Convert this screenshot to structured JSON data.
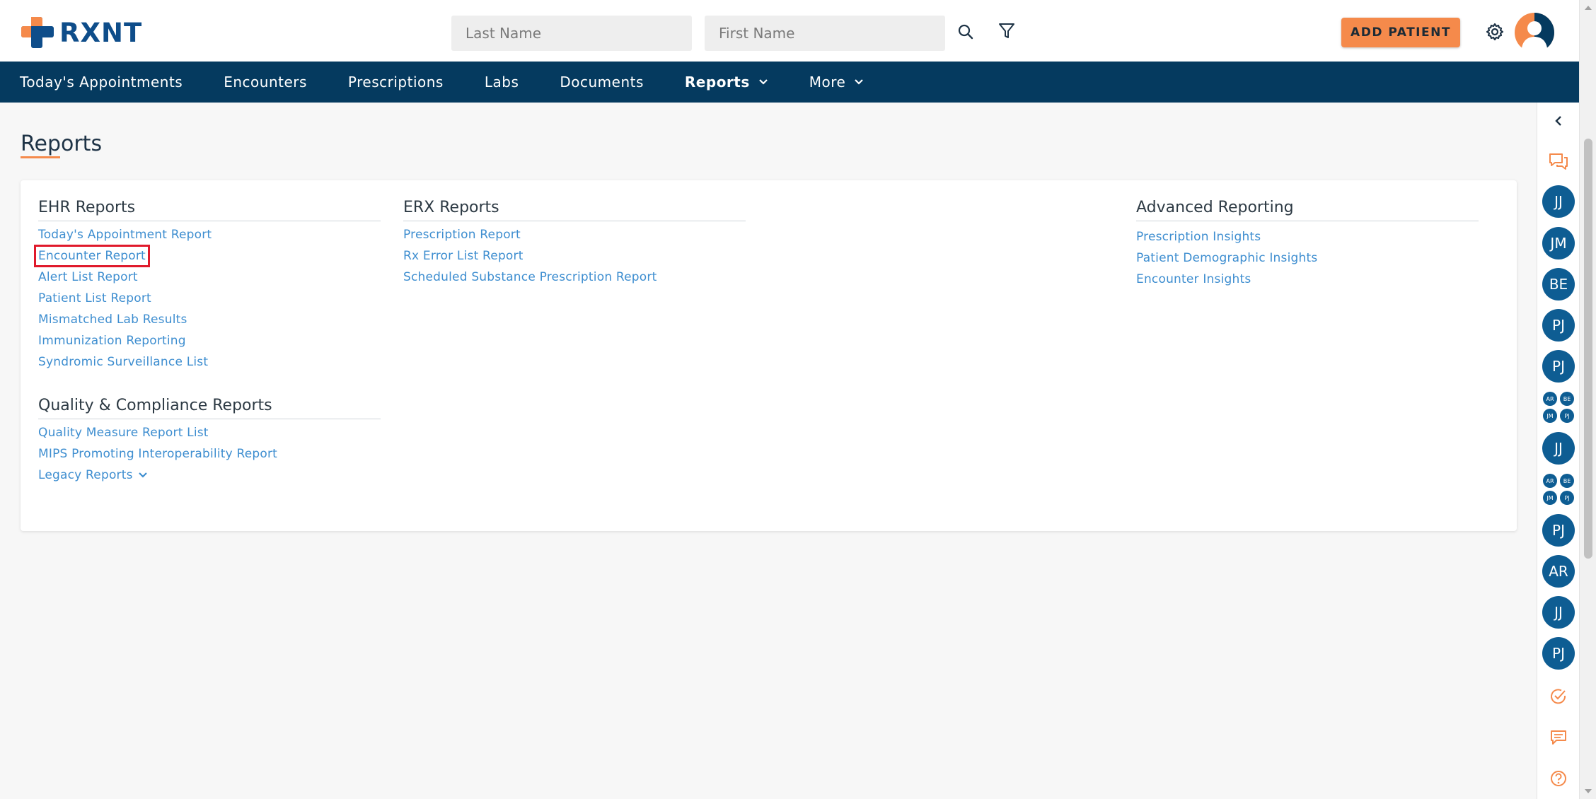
{
  "brand": {
    "name": "RXNT",
    "accent_orange": "#f58a4b",
    "navy": "#053a5f",
    "blue": "#0e4d8a"
  },
  "header": {
    "last_name_placeholder": "Last Name",
    "first_name_placeholder": "First Name",
    "search_icon": "search-icon",
    "filter_icon": "filter-icon",
    "add_patient_label": "ADD PATIENT",
    "settings_icon": "gear-icon",
    "avatar_icon": "user-avatar-icon"
  },
  "nav": {
    "items": [
      {
        "label": "Today's Appointments"
      },
      {
        "label": "Encounters"
      },
      {
        "label": "Prescriptions"
      },
      {
        "label": "Labs"
      },
      {
        "label": "Documents"
      },
      {
        "label": "Reports",
        "active": true,
        "dropdown": true
      },
      {
        "label": "More",
        "dropdown": true
      }
    ]
  },
  "page": {
    "title": "Reports"
  },
  "sections": {
    "ehr": {
      "title": "EHR Reports",
      "links": [
        "Today's Appointment Report",
        "Encounter Report",
        "Alert List Report",
        "Patient List Report",
        "Mismatched Lab Results",
        "Immunization Reporting",
        "Syndromic Surveillance List"
      ]
    },
    "quality": {
      "title": "Quality & Compliance Reports",
      "links": [
        "Quality Measure Report List",
        "MIPS Promoting Interoperability Report"
      ],
      "legacy_label": "Legacy Reports"
    },
    "erx": {
      "title": "ERX Reports",
      "links": [
        "Prescription Report",
        "Rx Error List Report",
        "Scheduled Substance Prescription Report"
      ]
    },
    "advanced": {
      "title": "Advanced Reporting",
      "links": [
        "Prescription Insights",
        "Patient Demographic Insights",
        "Encounter Insights"
      ]
    }
  },
  "right_rail": {
    "collapse_icon": "chevron-left-icon",
    "chat_icon": "chat-bubbles-icon",
    "avatars": {
      "a1": "JJ",
      "a2": "JM",
      "a3": "BE",
      "a4": "PJ",
      "a5": "PJ",
      "g1": [
        "AR",
        "BE",
        "JM",
        "PJ"
      ],
      "a6": "JJ",
      "g2": [
        "AR",
        "BE",
        "JM",
        "PJ"
      ],
      "a7": "PJ",
      "a8": "AR",
      "a9": "JJ",
      "a10": "PJ"
    },
    "tasks_icon": "check-circle-icon",
    "messages_icon": "message-icon",
    "help_icon": "help-circle-icon"
  }
}
